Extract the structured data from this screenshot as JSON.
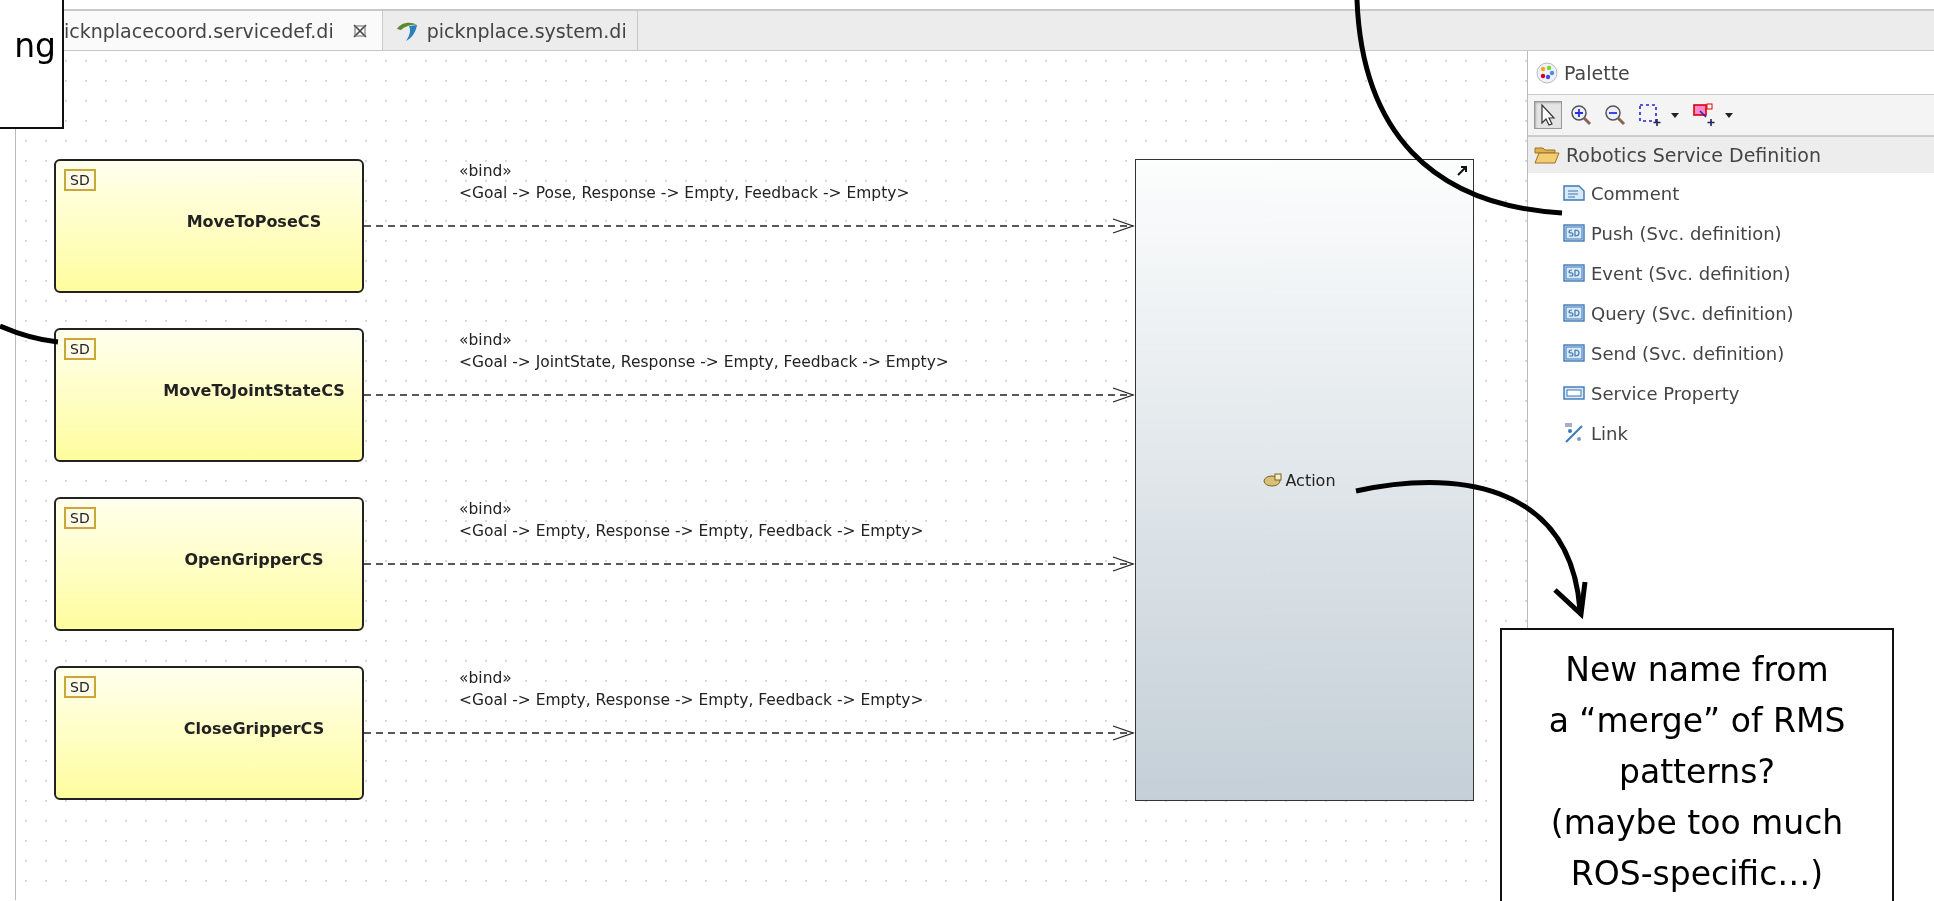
{
  "tabs": [
    {
      "label": "icknplacecoord.servicedef.di",
      "selected": true
    },
    {
      "label": "picknplace.system.di",
      "selected": false
    }
  ],
  "diagram": {
    "definitions": [
      {
        "badge": "SD",
        "name": "MoveToPoseCS",
        "stereotype": "«bind»",
        "binding": "<Goal -> Pose, Response -> Empty, Feedback -> Empty>"
      },
      {
        "badge": "SD",
        "name": "MoveToJointStateCS",
        "stereotype": "«bind»",
        "binding": "<Goal -> JointState, Response -> Empty, Feedback -> Empty>"
      },
      {
        "badge": "SD",
        "name": "OpenGripperCS",
        "stereotype": "«bind»",
        "binding": "<Goal -> Empty, Response -> Empty, Feedback -> Empty>"
      },
      {
        "badge": "SD",
        "name": "CloseGripperCS",
        "stereotype": "«bind»",
        "binding": "<Goal -> Empty, Response -> Empty, Feedback -> Empty>"
      }
    ],
    "target": {
      "label": "Action"
    }
  },
  "palette": {
    "title": "Palette",
    "tools": [
      {
        "kind": "select",
        "selected": true,
        "dropdown": false
      },
      {
        "kind": "zoom-in",
        "selected": false,
        "dropdown": false
      },
      {
        "kind": "zoom-out",
        "selected": false,
        "dropdown": false
      },
      {
        "kind": "marquee",
        "selected": false,
        "dropdown": true
      },
      {
        "kind": "connection",
        "selected": false,
        "dropdown": true
      }
    ],
    "drawer": {
      "label": "Robotics Service Definition",
      "expanded": true,
      "items": [
        {
          "kind": "comment",
          "label": "Comment"
        },
        {
          "kind": "definition",
          "label": "Push (Svc. definition)"
        },
        {
          "kind": "definition",
          "label": "Event (Svc. definition)"
        },
        {
          "kind": "definition",
          "label": "Query (Svc. definition)"
        },
        {
          "kind": "definition",
          "label": "Send (Svc. definition)"
        },
        {
          "kind": "property",
          "label": "Service Property"
        },
        {
          "kind": "link",
          "label": "Link"
        }
      ]
    }
  },
  "annotations": [
    {
      "kind": "top-left",
      "lines": [
        "ng"
      ]
    },
    {
      "kind": "bottom-right",
      "lines": [
        "New name from",
        "a “merge” of RMS",
        "patterns?",
        "(maybe too much",
        "ROS-specific…)"
      ]
    }
  ]
}
